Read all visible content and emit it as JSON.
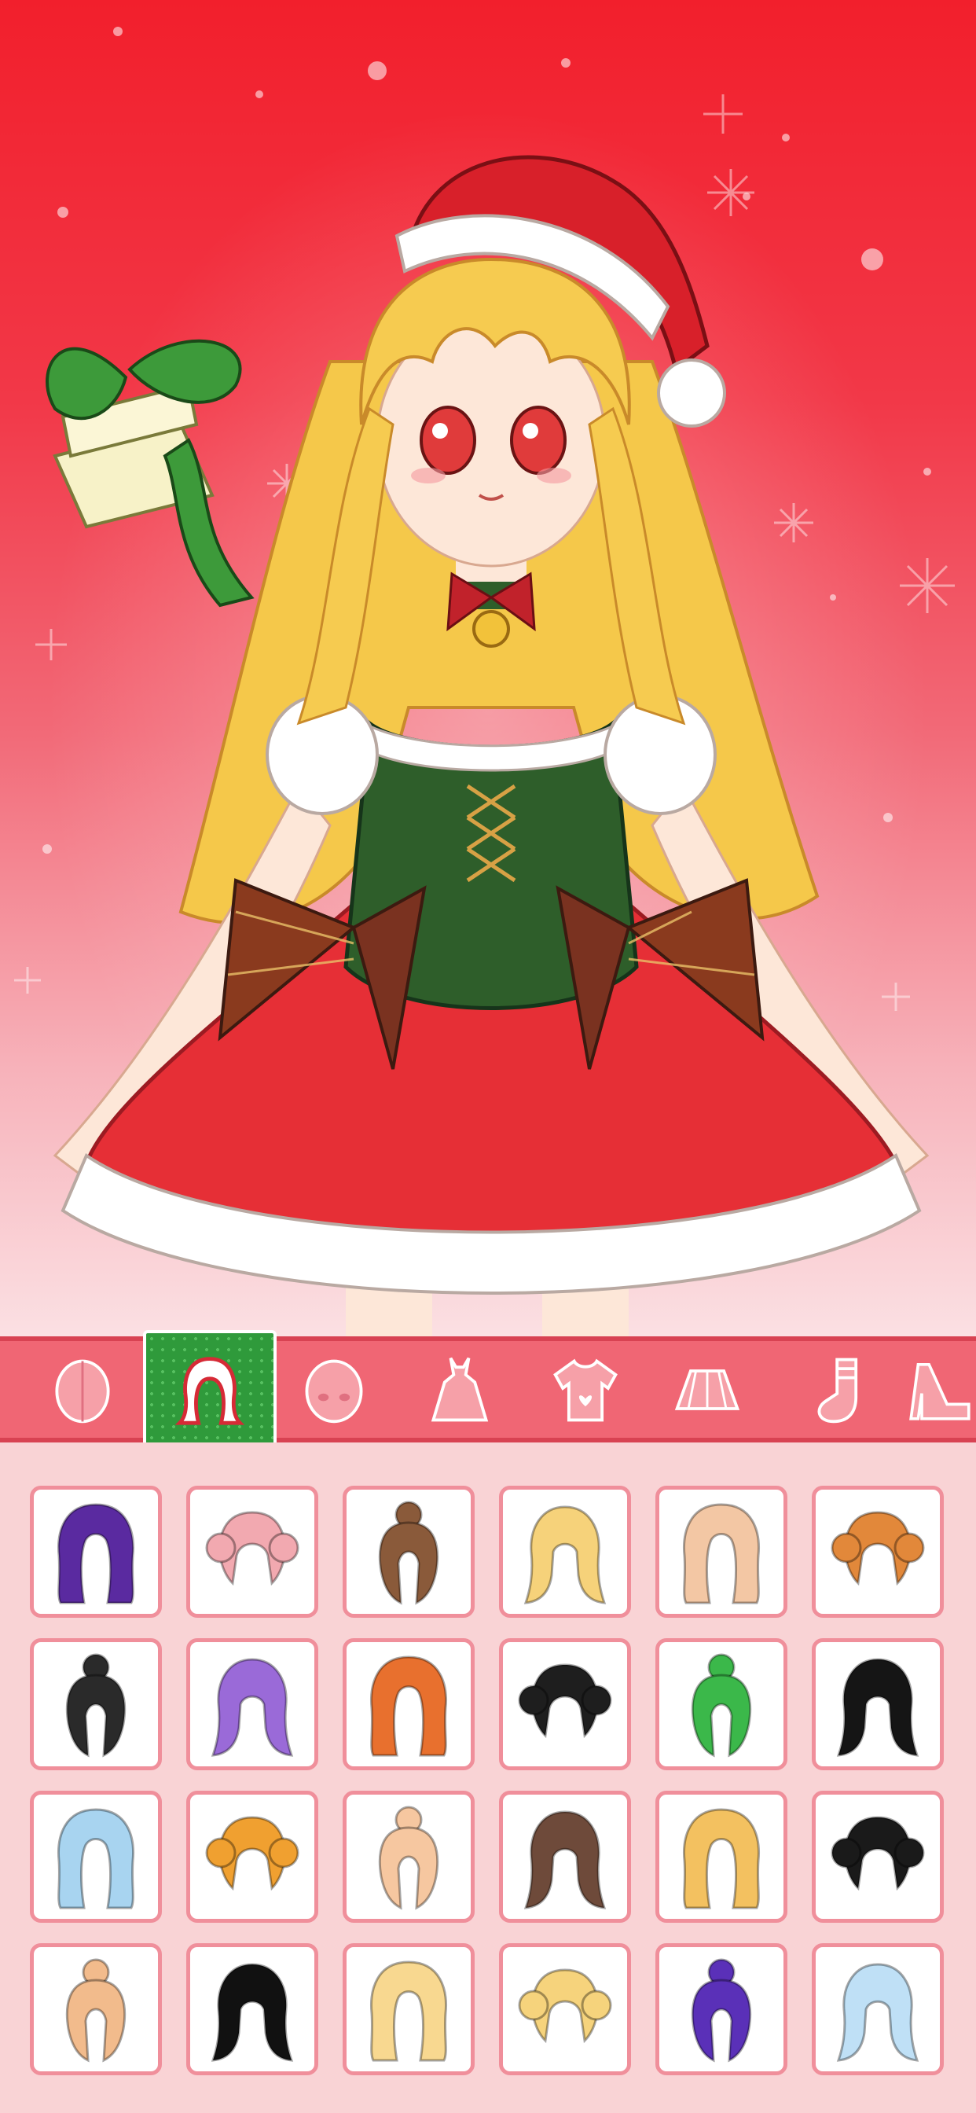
{
  "character": {
    "theme": "christmas",
    "hair": "long-golden-wavy",
    "hat": "santa-hat",
    "outfit": "green-corset-red-skirt",
    "accessory": "gift-box"
  },
  "colors": {
    "background_top": "#f21f2c",
    "toolbar": "#f06674",
    "active_tab": "#2f9a3b",
    "panel": "#f9d3d5",
    "cell_border": "#f08f9b"
  },
  "category_tabs": [
    {
      "icon": "face-shape-icon",
      "active": false
    },
    {
      "icon": "hair-icon",
      "active": true
    },
    {
      "icon": "head-eyes-icon",
      "active": false
    },
    {
      "icon": "dress-icon",
      "active": false
    },
    {
      "icon": "shirt-icon",
      "active": false
    },
    {
      "icon": "skirt-icon",
      "active": false
    },
    {
      "icon": "sock-icon",
      "active": false
    },
    {
      "icon": "shoe-icon",
      "active": false
    }
  ],
  "hair_options": [
    {
      "icon": "hair-style-icon",
      "color": "#5a2aa0"
    },
    {
      "icon": "hair-style-icon",
      "color": "#f2a9b0"
    },
    {
      "icon": "hair-style-icon",
      "color": "#8a5a3a"
    },
    {
      "icon": "hair-style-icon",
      "color": "#f6d27a"
    },
    {
      "icon": "hair-style-icon",
      "color": "#f3c7a4"
    },
    {
      "icon": "hair-style-icon",
      "color": "#e2883a"
    },
    {
      "icon": "hair-style-icon",
      "color": "#2a2a2a"
    },
    {
      "icon": "hair-style-icon",
      "color": "#9a6ad8"
    },
    {
      "icon": "hair-style-icon",
      "color": "#e8702e"
    },
    {
      "icon": "hair-style-icon",
      "color": "#1e1e1e"
    },
    {
      "icon": "hair-style-icon",
      "color": "#3bb84a"
    },
    {
      "icon": "hair-style-icon",
      "color": "#151515"
    },
    {
      "icon": "hair-style-icon",
      "color": "#a8d4f0"
    },
    {
      "icon": "hair-style-icon",
      "color": "#f0a030"
    },
    {
      "icon": "hair-style-icon",
      "color": "#f6c7a0"
    },
    {
      "icon": "hair-style-icon",
      "color": "#6e4a3a"
    },
    {
      "icon": "hair-style-icon",
      "color": "#f3c160"
    },
    {
      "icon": "hair-style-icon",
      "color": "#1a1a1a"
    },
    {
      "icon": "hair-style-icon",
      "color": "#f2bb8c"
    },
    {
      "icon": "hair-style-icon",
      "color": "#111111"
    },
    {
      "icon": "hair-style-icon",
      "color": "#f8d890"
    },
    {
      "icon": "hair-style-icon",
      "color": "#f6d37c"
    },
    {
      "icon": "hair-style-icon",
      "color": "#5a30b8"
    },
    {
      "icon": "hair-style-icon",
      "color": "#bfe0f6"
    }
  ]
}
